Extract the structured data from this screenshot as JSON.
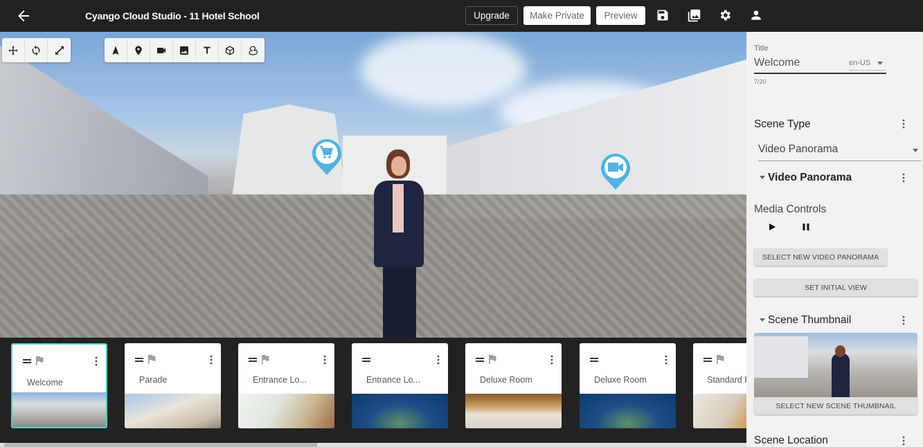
{
  "topbar": {
    "title": "Cyango Cloud Studio - 11 Hotel School",
    "buttons": {
      "upgrade": "Upgrade",
      "make_private": "Make Private",
      "preview": "Preview"
    },
    "icons": [
      "arrow-left-icon",
      "save-icon",
      "media-library-icon",
      "settings-gear-icon",
      "user-account-icon"
    ]
  },
  "viewer": {
    "nav_tools": [
      "move-icon",
      "rotate-icon",
      "resize-icon"
    ],
    "add_tools": [
      "navigation-arrow-icon",
      "map-pin-icon",
      "video-camera-icon",
      "image-icon",
      "text-icon",
      "3d-cube-icon",
      "duck-model-icon"
    ],
    "hotspots": [
      {
        "type": "shop",
        "icon": "shopping-cart-icon"
      },
      {
        "type": "video",
        "icon": "video-camera-icon"
      }
    ],
    "hotspot_color": "#4fb3e3"
  },
  "scenes": [
    {
      "label": "Welcome",
      "flagged": true,
      "selected": true
    },
    {
      "label": "Parade",
      "flagged": true,
      "selected": false
    },
    {
      "label": "Entrance Lo...",
      "flagged": true,
      "selected": false
    },
    {
      "label": "Entrance Lo...",
      "flagged": false,
      "selected": false
    },
    {
      "label": "Deluxe Room",
      "flagged": true,
      "selected": false
    },
    {
      "label": "Deluxe Room",
      "flagged": false,
      "selected": false
    },
    {
      "label": "Standard R",
      "flagged": true,
      "selected": false
    }
  ],
  "scene_strip": {
    "selected_color": "#4dd0c8"
  },
  "panel": {
    "title_label": "Title",
    "title_value": "Welcome",
    "language": "en-US",
    "title_counter": "7/20",
    "scene_type_heading": "Scene Type",
    "scene_type_value": "Video Panorama",
    "video_panorama_heading": "Video Panorama",
    "media_controls_label": "Media Controls",
    "select_video_button": "SELECT NEW VIDEO PANORAMA",
    "set_initial_view_button": "SET INITIAL VIEW",
    "scene_thumbnail_heading": "Scene Thumbnail",
    "select_thumbnail_button": "SELECT NEW SCENE THUMBNAIL",
    "scene_location_heading": "Scene Location"
  }
}
